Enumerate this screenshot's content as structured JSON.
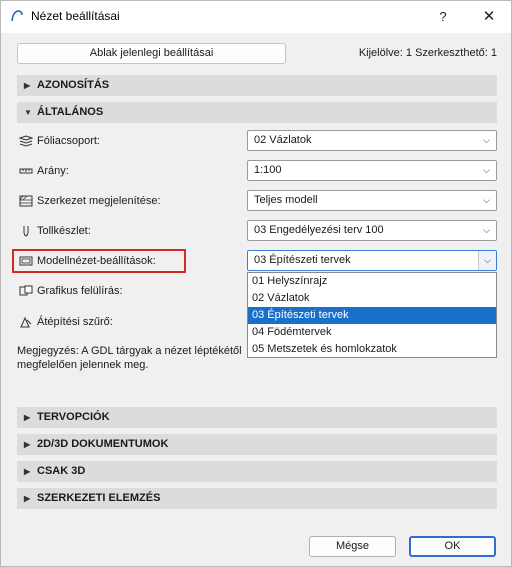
{
  "window": {
    "title": "Nézet beállításai",
    "help_label": "?",
    "close_label": "✕"
  },
  "top": {
    "button_label": "Ablak jelenlegi beállításai",
    "selection_info": "Kijelölve: 1 Szerkeszthető: 1"
  },
  "sections": {
    "azonositas": "AZONOSÍTÁS",
    "altalanos": "ÁLTALÁNOS",
    "tervopciok": "TERVOPCIÓK",
    "dokumentumok": "2D/3D DOKUMENTUMOK",
    "csak3d": "CSAK 3D",
    "szerkezeti": "SZERKEZETI ELEMZÉS"
  },
  "general": {
    "foliacsoport": {
      "label": "Fóliacsoport:",
      "value": "02 Vázlatok",
      "icon": "layers-icon"
    },
    "arany": {
      "label": "Arány:",
      "value": "1:100",
      "icon": "ruler-icon"
    },
    "szerkezet": {
      "label": "Szerkezet megjelenítése:",
      "value": "Teljes modell",
      "icon": "structure-icon"
    },
    "tollkeszlet": {
      "label": "Tollkészlet:",
      "value": "03 Engedélyezési terv 100",
      "icon": "pen-icon"
    },
    "modellnezet": {
      "label": "Modellnézet-beállítások:",
      "value": "03 Építészeti tervek",
      "icon": "model-view-icon"
    },
    "grafikus": {
      "label": "Grafikus felülírás:",
      "icon": "override-icon"
    },
    "atepitesi": {
      "label": "Átépítési szűrő:",
      "icon": "renovation-filter-icon"
    }
  },
  "dropdown": {
    "options": [
      "01 Helyszínrajz",
      "02 Vázlatok",
      "03 Építészeti tervek",
      "04 Födémtervek",
      "05 Metszetek és homlokzatok"
    ],
    "selected_index": 2
  },
  "note": {
    "line1": "Megjegyzés: A GDL tárgyak a nézet léptékétől",
    "line2": "megfelelően jelennek meg."
  },
  "footer": {
    "cancel_label": "Mégse",
    "ok_label": "OK"
  },
  "colors": {
    "highlight": "#d52a2a",
    "selection": "#1a6fc9",
    "section_bg": "#dcdcdc"
  }
}
